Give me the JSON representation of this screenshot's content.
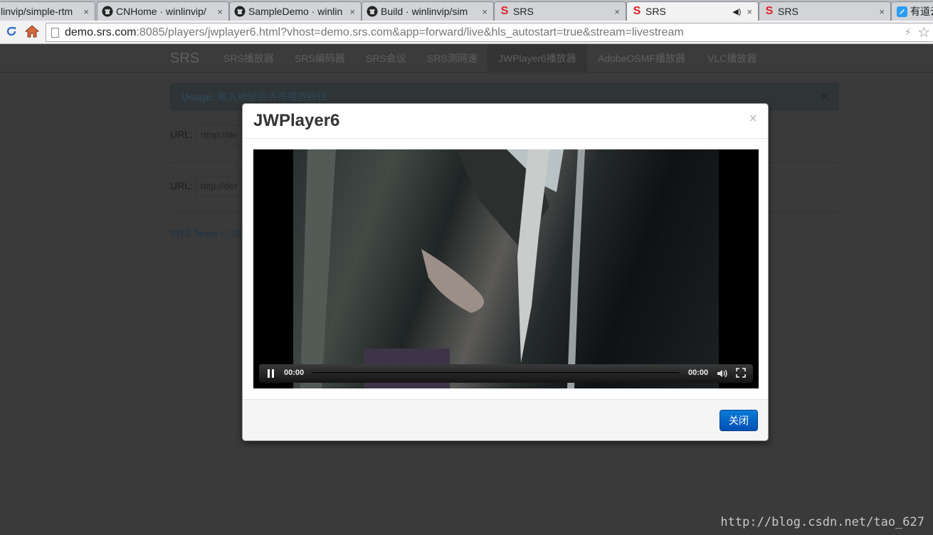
{
  "browser": {
    "tabs": [
      {
        "title": "linvip/simple-rtm",
        "icon": "none"
      },
      {
        "title": "CNHome · winlinvip/",
        "icon": "github-icon"
      },
      {
        "title": "SampleDemo · winlin",
        "icon": "github-icon"
      },
      {
        "title": "Build · winlinvip/sim",
        "icon": "github-icon"
      },
      {
        "title": "SRS",
        "icon": "srs-icon"
      },
      {
        "title": "SRS",
        "icon": "srs-icon",
        "active": true,
        "audio": true
      },
      {
        "title": "SRS",
        "icon": "srs-icon"
      },
      {
        "title": "有道云",
        "icon": "youdao-icon"
      }
    ],
    "close_glyph": "×",
    "url_host": "demo.srs.com",
    "url_rest": ":8085/players/jwplayer6.html?vhost=demo.srs.com&app=forward/live&hls_autostart=true&stream=livestream"
  },
  "navbar": {
    "brand": "SRS",
    "items": [
      "SRS播放器",
      "SRS编码器",
      "SRS会议",
      "SRS测网速",
      "JWPlayer6播放器",
      "AdobeOSMF播放器",
      "VLC播放器"
    ],
    "active_index": 4
  },
  "alert": {
    "strong": "Usage:",
    "text": "输入地址后点击播放按钮",
    "close": "×"
  },
  "url_rows": [
    {
      "label": "URL:",
      "value": "rtmp://de"
    },
    {
      "label": "URL:",
      "value": "http://der"
    }
  ],
  "footer": "SRS Team © 20",
  "modal": {
    "title": "JWPlayer6",
    "close": "×",
    "player": {
      "time_current": "00:00",
      "time_total": "00:00"
    },
    "button_close": "关闭"
  },
  "watermark": "http://blog.csdn.net/tao_627",
  "colors": {
    "accent": "#0a6fd1",
    "overlay": "#3a3a3a",
    "srs_red": "#e02020"
  }
}
